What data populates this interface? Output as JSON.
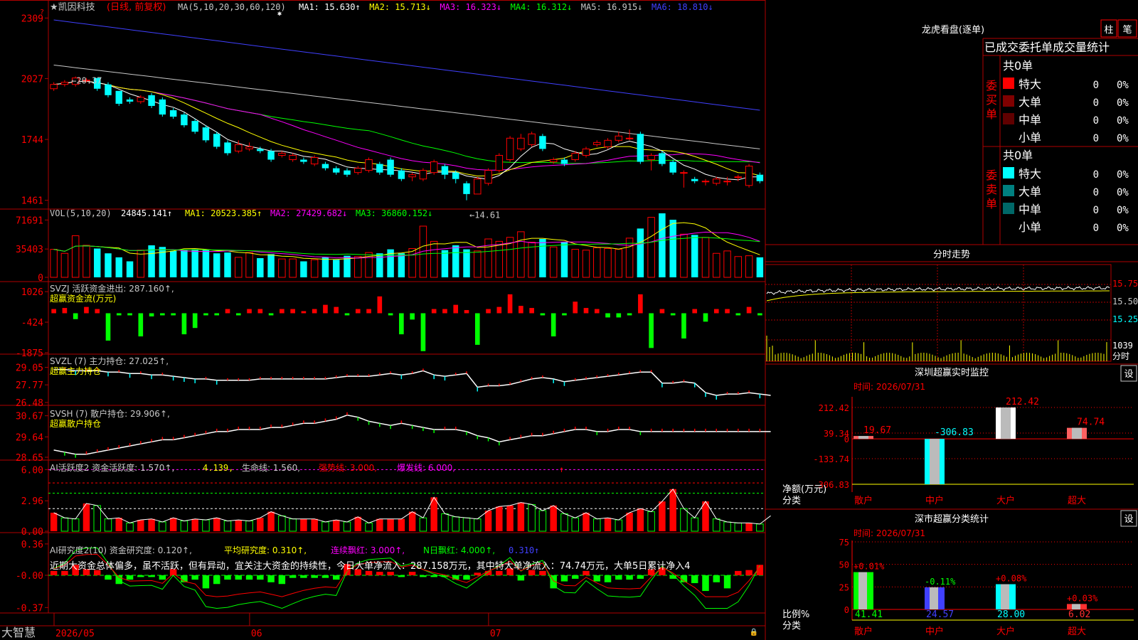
{
  "colors": {
    "up": "#ff0000",
    "down": "#00ffff",
    "green": "#00ff00",
    "yellow": "#ffff00",
    "magenta": "#ff00ff",
    "grid": "#b00000",
    "white": "#ffffff",
    "gray": "#c8c8c8",
    "blue": "#4040ff",
    "ma4": "#00c000"
  },
  "main": {
    "head": {
      "name": "★凯因科技",
      "mode": "(日线, 前复权)",
      "ma_label": "MA(5,10,20,30,60,120)",
      "items": [
        {
          "text": "MA1: 15.630↑",
          "color": "#ffffff"
        },
        {
          "text": "MA2: 15.713↓",
          "color": "#ffff00"
        },
        {
          "text": "MA3: 16.323↓",
          "color": "#ff00ff"
        },
        {
          "text": "MA4: 16.312↓",
          "color": "#00ff00"
        },
        {
          "text": "MA5: 16.915↓",
          "color": "#c8c8c8"
        },
        {
          "text": "MA6: 18.810↓",
          "color": "#4040ff"
        }
      ]
    },
    "yticks": [
      {
        "v": 23.09,
        "label": "2309"
      },
      {
        "v": 20.27,
        "label": "2027"
      },
      {
        "v": 17.44,
        "label": "1744"
      },
      {
        "v": 14.61,
        "label": "1461"
      }
    ],
    "max_label": "←20.37",
    "min_label": "←14.61",
    "ylim": [
      14.4,
      23.2
    ]
  },
  "vol": {
    "head": {
      "name": "VOL(5,10,20)",
      "value": "24845.141↑",
      "items": [
        {
          "text": "MA1: 20523.385↑",
          "color": "#ffff00"
        },
        {
          "text": "MA2: 27429.682↓",
          "color": "#ff00ff"
        },
        {
          "text": "MA3: 36860.152↓",
          "color": "#00ff00"
        }
      ]
    },
    "yticks": [
      {
        "v": 71691,
        "label": "71691"
      },
      {
        "v": 35403,
        "label": "35403"
      },
      {
        "v": 0,
        "label": "0"
      }
    ],
    "ylim": [
      0,
      80000
    ]
  },
  "flow": {
    "head": {
      "name": "SVZJ  活跃资金进出: 287.160↑,",
      "sub": "超赢资金流(万元)"
    },
    "yticks": [
      {
        "v": 1026,
        "label": "1026"
      },
      {
        "v": -424,
        "label": "-424"
      },
      {
        "v": -1875,
        "label": "-1875"
      }
    ],
    "ylim": [
      -1875,
      1300
    ]
  },
  "main_hold": {
    "head": {
      "name": "SVZL (7) 主力持仓: 27.025↑,",
      "sub": "超赢主力持仓"
    },
    "yticks": [
      {
        "v": 29.05,
        "label": "29.05"
      },
      {
        "v": 27.77,
        "label": "27.77"
      },
      {
        "v": 26.48,
        "label": "26.48"
      }
    ],
    "ylim": [
      26.48,
      29.6
    ]
  },
  "retail_hold": {
    "head": {
      "name": "SVSH (7) 散户持仓: 29.906↑,",
      "sub": "超赢散户持仓"
    },
    "yticks": [
      {
        "v": 30.67,
        "label": "30.67"
      },
      {
        "v": 29.64,
        "label": "29.64"
      },
      {
        "v": 28.65,
        "label": "28.65"
      }
    ],
    "ylim": [
      28.65,
      30.9
    ]
  },
  "active": {
    "head": {
      "name": "AI活跃度2 资金活跃度: 1.570↑,",
      "v2": "4.139,",
      "life": "生命线: 1.560,",
      "strong": "强势线: 3.000,",
      "burst": "爆发线: 6.000,"
    },
    "yticks": [
      {
        "v": 6,
        "label": "6.00"
      },
      {
        "v": 2.96,
        "label": "2.96"
      },
      {
        "v": 0,
        "label": "0.00"
      }
    ],
    "ylim": [
      0,
      6.3
    ]
  },
  "research": {
    "head": {
      "name": "AI研究度2(10) 资金研究度: 0.120↑,",
      "avg": "平均研究度: 0.310↑,",
      "red": "连续飘红: 3.000↑,",
      "nred": "N日飘红: 4.000↑,",
      "v5": "0.310↑"
    },
    "note": "近期大资金总体偏多，虽不活跃，但有异动，宜关注大资金的持续性，今日大单净流入：287.158万元，其中特大单净流入：74.74万元，大单5日累计净入4",
    "yticks": [
      {
        "v": 0.36,
        "label": "0.36"
      },
      {
        "v": 0,
        "label": "-0.00"
      },
      {
        "v": -0.37,
        "label": "-0.37"
      }
    ],
    "ylim": [
      -0.4,
      0.4
    ]
  },
  "xaxis": {
    "brand": "大智慧",
    "labels": [
      {
        "i": 0,
        "text": "2026/05"
      },
      {
        "i": 18,
        "text": "06"
      },
      {
        "i": 40,
        "text": "07"
      }
    ]
  },
  "chart_data": {
    "type": "candlestick",
    "open": [
      19.8,
      20.0,
      20.0,
      20.2,
      20.3,
      20.0,
      19.7,
      19.3,
      19.2,
      19.5,
      19.3,
      18.8,
      18.6,
      18.3,
      18.0,
      17.7,
      17.3,
      16.9,
      17.0,
      17.0,
      16.9,
      16.7,
      16.5,
      16.5,
      16.3,
      16.3,
      16.1,
      16.0,
      15.9,
      16.0,
      16.3,
      16.5,
      16.0,
      15.7,
      15.6,
      15.9,
      16.2,
      15.9,
      15.4,
      14.9,
      15.4,
      16.0,
      16.5,
      17.0,
      17.2,
      17.6,
      16.4,
      16.5,
      16.5,
      16.7,
      17.2,
      17.1,
      17.4,
      17.5,
      17.7,
      16.5,
      16.8,
      16.4,
      15.9,
      15.6,
      15.5,
      15.4,
      15.5,
      15.7,
      15.3,
      15.8
    ],
    "close": [
      20.0,
      20.1,
      20.3,
      20.2,
      19.8,
      19.5,
      19.1,
      19.2,
      19.4,
      19.0,
      18.6,
      18.5,
      18.1,
      17.8,
      17.4,
      17.1,
      16.8,
      17.2,
      17.1,
      16.9,
      16.5,
      16.8,
      16.7,
      16.4,
      16.6,
      16.1,
      15.9,
      15.8,
      16.1,
      16.5,
      15.9,
      15.8,
      15.6,
      15.8,
      16.0,
      16.4,
      15.8,
      15.6,
      14.9,
      15.6,
      16.0,
      16.7,
      17.5,
      17.5,
      17.7,
      17.0,
      16.5,
      16.3,
      16.8,
      17.0,
      17.3,
      17.4,
      17.6,
      17.5,
      16.4,
      16.7,
      16.3,
      15.9,
      15.9,
      15.5,
      15.5,
      15.6,
      15.5,
      15.7,
      16.2,
      15.5
    ],
    "high": [
      20.1,
      20.2,
      20.37,
      20.3,
      20.3,
      20.1,
      19.7,
      19.4,
      19.5,
      19.6,
      19.4,
      18.9,
      18.7,
      18.4,
      18.1,
      17.8,
      17.4,
      17.4,
      17.3,
      17.1,
      17.0,
      16.9,
      16.8,
      16.6,
      16.7,
      16.4,
      16.2,
      16.1,
      16.2,
      16.6,
      16.4,
      16.6,
      16.1,
      15.9,
      16.1,
      16.5,
      16.3,
      16.0,
      15.5,
      15.7,
      16.1,
      16.8,
      17.6,
      17.7,
      17.8,
      17.7,
      16.6,
      16.6,
      16.9,
      17.1,
      17.4,
      17.5,
      17.8,
      17.9,
      17.8,
      16.8,
      16.9,
      16.5,
      16.0,
      15.7,
      15.6,
      15.7,
      15.7,
      15.8,
      16.3,
      15.9
    ],
    "low": [
      19.7,
      19.9,
      19.9,
      20.1,
      19.7,
      19.4,
      19.0,
      19.1,
      19.1,
      18.9,
      18.5,
      18.4,
      18.0,
      17.7,
      17.3,
      17.0,
      16.7,
      16.8,
      16.9,
      16.8,
      16.4,
      16.6,
      16.4,
      16.3,
      16.2,
      16.0,
      15.8,
      15.7,
      15.8,
      15.9,
      15.8,
      15.7,
      15.5,
      15.5,
      15.5,
      15.8,
      15.6,
      15.4,
      14.61,
      14.9,
      15.3,
      15.9,
      16.4,
      16.9,
      17.1,
      16.9,
      16.3,
      16.2,
      16.4,
      16.6,
      17.1,
      17.0,
      17.3,
      17.4,
      16.3,
      16.0,
      16.2,
      15.8,
      15.2,
      15.4,
      15.3,
      15.3,
      15.3,
      15.5,
      15.2,
      15.4
    ],
    "volume": [
      35000,
      30000,
      52000,
      40000,
      36000,
      30000,
      25000,
      20000,
      34000,
      40000,
      38000,
      33000,
      34000,
      35000,
      35000,
      30000,
      31000,
      25000,
      31000,
      24000,
      29000,
      23000,
      23000,
      20000,
      22000,
      25000,
      22000,
      27000,
      26000,
      31000,
      30000,
      35000,
      30000,
      36000,
      64000,
      45000,
      34000,
      40000,
      35000,
      33000,
      48000,
      45000,
      50000,
      57000,
      44000,
      48000,
      38000,
      44000,
      35000,
      34000,
      37000,
      36000,
      35000,
      49000,
      61000,
      75000,
      80000,
      72000,
      54000,
      53000,
      50000,
      30000,
      33000,
      26000,
      27000,
      25000,
      33000,
      33000
    ],
    "flow": [
      200,
      250,
      -280,
      300,
      200,
      -1300,
      -100,
      -100,
      -1100,
      -150,
      -100,
      -100,
      -1000,
      -700,
      -100,
      -100,
      200,
      -100,
      200,
      200,
      -100,
      200,
      200,
      100,
      200,
      400,
      300,
      -100,
      200,
      200,
      800,
      -100,
      -1000,
      -300,
      -1800,
      200,
      200,
      400,
      150,
      -1500,
      200,
      300,
      900,
      350,
      250,
      -100,
      -1100,
      -100,
      550,
      250,
      200,
      -200,
      -200,
      -100,
      900,
      -1650,
      200,
      -100,
      -1200,
      200,
      -400,
      200,
      200,
      -100,
      300,
      -100,
      300
    ],
    "main_hold": [
      28.9,
      28.9,
      28.8,
      28.8,
      28.8,
      28.7,
      28.7,
      28.6,
      28.6,
      28.5,
      28.5,
      28.4,
      28.3,
      28.2,
      28.2,
      28.1,
      28.1,
      28.1,
      28.1,
      28.2,
      28.2,
      28.2,
      28.2,
      28.2,
      28.2,
      28.2,
      28.3,
      28.4,
      28.4,
      28.4,
      28.5,
      28.6,
      28.5,
      28.6,
      28.8,
      28.5,
      28.4,
      28.5,
      28.6,
      27.6,
      27.7,
      27.7,
      27.8,
      28.0,
      28.2,
      28.3,
      28.2,
      28.0,
      28.1,
      28.2,
      28.3,
      28.4,
      28.5,
      28.6,
      28.7,
      28.7,
      27.9,
      27.9,
      28.0,
      27.9,
      27.2,
      27.0,
      27.1,
      27.1,
      27.2,
      27.1,
      27.0
    ],
    "retail_hold": [
      29.0,
      28.9,
      28.8,
      28.8,
      28.9,
      29.0,
      29.1,
      29.2,
      29.3,
      29.4,
      29.5,
      29.5,
      29.6,
      29.7,
      29.8,
      29.9,
      29.9,
      30.0,
      30.0,
      30.0,
      30.1,
      30.1,
      30.2,
      30.3,
      30.3,
      30.4,
      30.5,
      30.7,
      30.6,
      30.4,
      30.3,
      30.2,
      30.3,
      30.2,
      30.1,
      30.0,
      30.0,
      30.0,
      29.9,
      29.7,
      29.6,
      29.4,
      29.5,
      29.6,
      29.7,
      29.7,
      29.8,
      29.9,
      30.0,
      30.0,
      29.9,
      29.9,
      30.0,
      30.0,
      29.9,
      29.9,
      29.9,
      29.9,
      29.9,
      29.9,
      29.9,
      29.9,
      29.9,
      29.9,
      29.9,
      29.9,
      29.9
    ],
    "active": [
      1.8,
      1.3,
      1.2,
      2.7,
      2.5,
      1.2,
      1.3,
      0.8,
      1.1,
      1.2,
      0.9,
      1.3,
      1.0,
      1.2,
      1.1,
      1.3,
      1.0,
      1.1,
      1.0,
      1.3,
      1.9,
      1.5,
      1.2,
      1.2,
      1.2,
      0.9,
      1.1,
      0.9,
      1.4,
      0.8,
      1.2,
      1.2,
      1.2,
      1.9,
      1.3,
      3.3,
      1.7,
      1.4,
      1.3,
      1.2,
      2.0,
      2.4,
      2.5,
      2.8,
      2.6,
      2.0,
      2.5,
      1.7,
      1.3,
      1.8,
      1.2,
      1.3,
      1.1,
      1.8,
      2.2,
      1.9,
      2.9,
      4.1,
      2.2,
      1.3,
      2.9,
      1.2,
      0.9,
      0.8,
      0.8,
      0.7,
      1.5
    ],
    "research": [
      0.05,
      0.05,
      0.12,
      0.07,
      0.06,
      -0.05,
      -0.1,
      -0.05,
      -0.02,
      -0.02,
      -0.05,
      0.07,
      -0.08,
      -0.05,
      -0.15,
      -0.1,
      -0.05,
      -0.05,
      -0.05,
      -0.05,
      -0.08,
      -0.1,
      -0.03,
      -0.03,
      -0.03,
      -0.03,
      -0.05,
      0.13,
      0.07,
      0.05,
      0.04,
      0.04,
      -0.02,
      0.04,
      -0.02,
      -0.02,
      -0.02,
      -0.05,
      -0.05,
      0.03,
      0.05,
      0.05,
      0.08,
      -0.06,
      0.06,
      0.05,
      -0.15,
      -0.07,
      -0.04,
      0.05,
      -0.07,
      -0.08,
      -0.05,
      -0.05,
      -0.04,
      0.07,
      0.09,
      -0.04,
      -0.08,
      -0.09,
      -0.18,
      -0.08,
      -0.15,
      0.05,
      0.06,
      0.12
    ]
  },
  "right": {
    "lhb": {
      "title": "龙虎看盘(逐单)",
      "btn_bar": "柱",
      "btn_line": "笔",
      "tabs": "已成交委托单成交量统计",
      "buy": {
        "side": "委买单",
        "total": "共0单",
        "rows": [
          {
            "name": "特大",
            "v": "0",
            "p": "0%",
            "color": "#ff0000"
          },
          {
            "name": "大单",
            "v": "0",
            "p": "0%",
            "color": "#800000"
          },
          {
            "name": "中单",
            "v": "0",
            "p": "0%",
            "color": "#600000"
          },
          {
            "name": "小单",
            "v": "0",
            "p": "0%",
            "color": "#000000"
          }
        ]
      },
      "sell": {
        "side": "委卖单",
        "total": "共0单",
        "rows": [
          {
            "name": "特大",
            "v": "0",
            "p": "0%",
            "color": "#00ffff"
          },
          {
            "name": "大单",
            "v": "0",
            "p": "0%",
            "color": "#008080"
          },
          {
            "name": "中单",
            "v": "0",
            "p": "0%",
            "color": "#006868"
          },
          {
            "name": "小单",
            "v": "0",
            "p": "0%",
            "color": "#000000"
          }
        ]
      }
    },
    "intraday": {
      "title": "分时走势",
      "yticks": [
        "15.75",
        "15.50",
        "15.25"
      ],
      "vol_label": "1039",
      "vol_label2": "分时"
    },
    "monitor": {
      "title": "深圳超赢实时监控",
      "btn": "设",
      "time": "时间: 2026/07/31",
      "ylabel": "净额(万元)",
      "xlabel": "分类",
      "yticks": [
        {
          "v": 212.42,
          "label": "212.42"
        },
        {
          "v": 39.34,
          "label": "39.34"
        },
        {
          "v": 0,
          "label": "0"
        },
        {
          "v": -133.74,
          "label": "-133.74"
        },
        {
          "v": -306.83,
          "label": "-306.83"
        }
      ],
      "bars": [
        {
          "name": "散户",
          "v": 19.67,
          "label": "19.67",
          "color": "#ff6060"
        },
        {
          "name": "中户",
          "v": -306.83,
          "label": "-306.83",
          "color": "#00ffff"
        },
        {
          "name": "大户",
          "v": 212.42,
          "label": "212.42",
          "color": "#ffffff"
        },
        {
          "name": "超大",
          "v": 74.74,
          "label": "74.74",
          "color": "#ff6060"
        }
      ]
    },
    "classify": {
      "title": "深市超赢分类统计",
      "btn": "设",
      "time": "时间: 2026/07/31",
      "ylabel": "比例%",
      "xlabel": "分类",
      "yticks": [
        75,
        50,
        25,
        0
      ],
      "bars": [
        {
          "name": "散户",
          "v": 41.41,
          "label": "41.41",
          "chg": "+0.01%",
          "color": "#00ff00",
          "chgColor": "#ff0000"
        },
        {
          "name": "中户",
          "v": 24.57,
          "label": "24.57",
          "chg": "-0.11%",
          "color": "#4040ff",
          "chgColor": "#00ff00"
        },
        {
          "name": "大户",
          "v": 28.0,
          "label": "28.00",
          "chg": "+0.08%",
          "color": "#00ffff",
          "chgColor": "#ff0000"
        },
        {
          "name": "超大",
          "v": 6.02,
          "label": "6.02",
          "chg": "+0.03%",
          "color": "#ff3030",
          "chgColor": "#ff0000"
        }
      ]
    }
  }
}
